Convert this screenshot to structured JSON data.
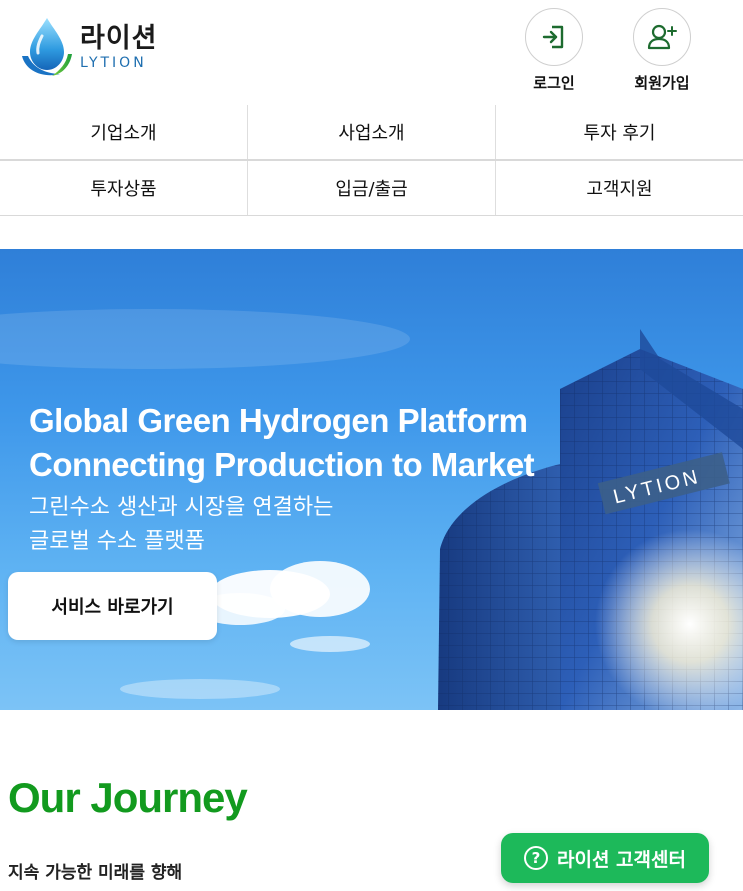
{
  "header": {
    "logo_ko": "라이션",
    "logo_en": "LYTION",
    "login_label": "로그인",
    "signup_label": "회원가입"
  },
  "nav": {
    "row1": [
      "기업소개",
      "사업소개",
      "투자 후기"
    ],
    "row2": [
      "투자상품",
      "입금/출금",
      "고객지원"
    ]
  },
  "hero": {
    "title_line1": "Global Green Hydrogen Platform",
    "title_line2": "Connecting Production to Market",
    "sub_line1": "그린수소 생산과 시장을 연결하는",
    "sub_line2": "글로벌 수소 플랫폼",
    "cta_label": "서비스 바로가기",
    "building_sign": "LYTION"
  },
  "journey": {
    "title": "Our Journey",
    "subtitle": "지속 가능한 미래를 향해"
  },
  "support": {
    "icon": "?",
    "label": "라이션 고객센터"
  },
  "colors": {
    "brand_green": "#129a1e",
    "support_green": "#1db95a",
    "logo_blue": "#1f6fb0"
  }
}
